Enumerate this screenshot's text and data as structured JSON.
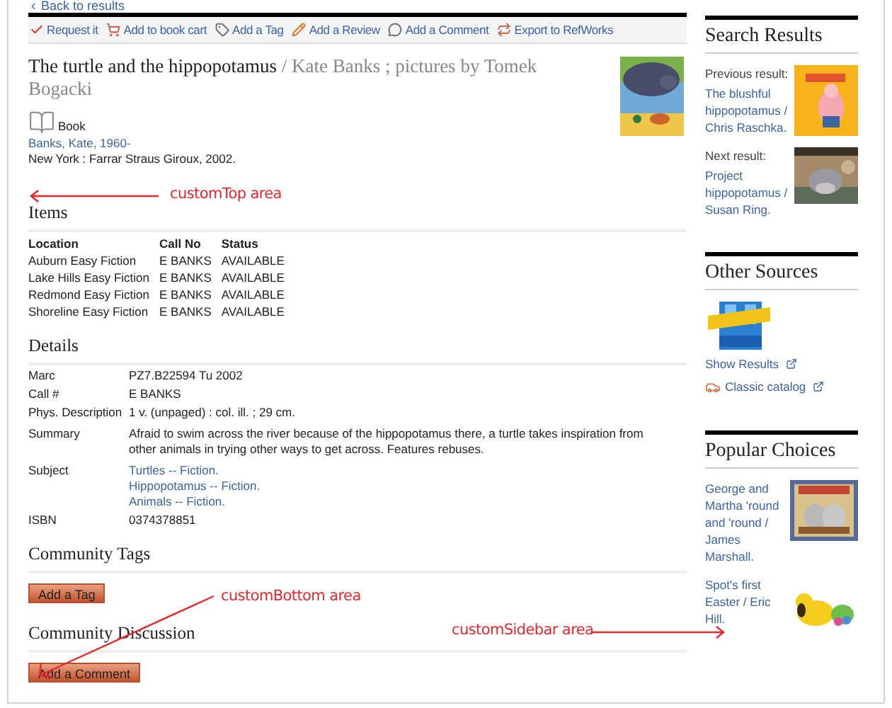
{
  "back_link": "Back to results",
  "toolbar": [
    {
      "label": "Request it",
      "kind": "request"
    },
    {
      "label": "Add to book cart",
      "kind": "cart"
    },
    {
      "label": "Add a Tag",
      "kind": "tag"
    },
    {
      "label": "Add a Review",
      "kind": "review"
    },
    {
      "label": "Add a Comment",
      "kind": "comment"
    },
    {
      "label": "Export to RefWorks",
      "kind": "export"
    }
  ],
  "record": {
    "title": "The turtle and the hippopotamus",
    "responsibility": "/ Kate Banks ; pictures by Tomek Bogacki",
    "format": "Book",
    "author": "Banks, Kate, 1960-",
    "publication": "New York : Farrar Straus Giroux, 2002."
  },
  "items": {
    "heading": "Items",
    "columns": [
      "Location",
      "Call No",
      "Status"
    ],
    "rows": [
      [
        "Auburn Easy Fiction",
        "E BANKS",
        "AVAILABLE"
      ],
      [
        "Lake Hills Easy Fiction",
        "E BANKS",
        "AVAILABLE"
      ],
      [
        "Redmond Easy Fiction",
        "E BANKS",
        "AVAILABLE"
      ],
      [
        "Shoreline Easy Fiction",
        "E BANKS",
        "AVAILABLE"
      ]
    ]
  },
  "details": {
    "heading": "Details",
    "rows": [
      {
        "label": "Marc",
        "kind": "text",
        "values": [
          "PZ7.B22594 Tu 2002"
        ]
      },
      {
        "label": "Call #",
        "kind": "text",
        "values": [
          "E BANKS"
        ]
      },
      {
        "label": "Phys. Description",
        "kind": "text",
        "values": [
          "1 v. (unpaged) : col. ill. ; 29 cm."
        ]
      },
      {
        "label": "Summary",
        "kind": "text",
        "values": [
          "Afraid to swim across the river because of the hippopotamus there, a turtle takes inspiration from other animals in trying other ways to get across. Features rebuses."
        ]
      },
      {
        "label": "Subject",
        "kind": "links",
        "values": [
          "Turtles -- Fiction.",
          "Hippopotamus -- Fiction.",
          "Animals -- Fiction."
        ]
      },
      {
        "label": "ISBN",
        "kind": "text",
        "values": [
          "0374378851"
        ]
      }
    ]
  },
  "community_tags": {
    "heading": "Community Tags",
    "button": "Add a Tag"
  },
  "community_discussion": {
    "heading": "Community Discussion",
    "button": "Add a Comment"
  },
  "sidebar": {
    "search_results": {
      "heading": "Search Results",
      "results": [
        {
          "label": "Previous result:",
          "title": "The blushful hippopotamus / Chris Raschka."
        },
        {
          "label": "Next result:",
          "title": "Project hippopotamus / Susan Ring."
        }
      ]
    },
    "other_sources": {
      "heading": "Other Sources",
      "links": [
        {
          "label": "Show Results",
          "kind": "external"
        },
        {
          "label": "Classic catalog",
          "kind": "catalog"
        }
      ]
    },
    "popular_choices": {
      "heading": "Popular Choices",
      "items": [
        {
          "title": "George and Martha 'round and 'round / James Marshall."
        },
        {
          "title": "Spot's first Easter / Eric Hill."
        }
      ]
    }
  },
  "annotations": [
    {
      "label": "customTop area",
      "kind": "top"
    },
    {
      "label": "customBottom area",
      "kind": "bottom"
    },
    {
      "label": "customSidebar area",
      "kind": "sidebar"
    }
  ]
}
